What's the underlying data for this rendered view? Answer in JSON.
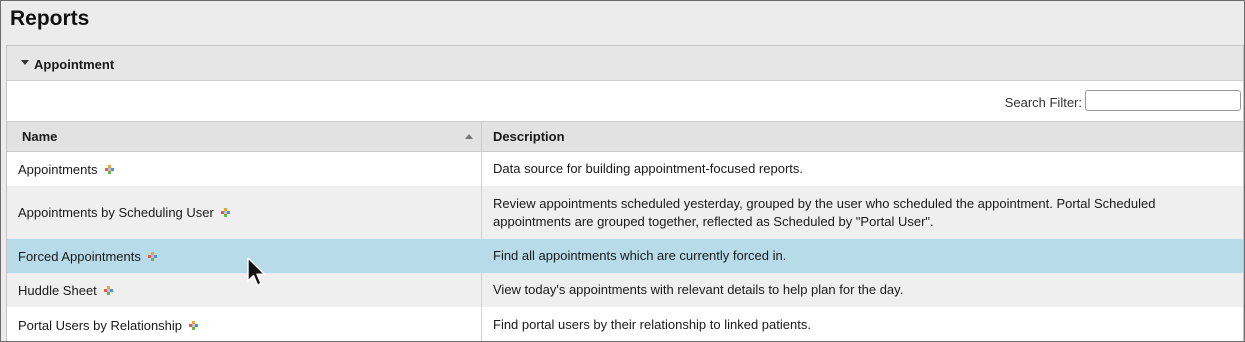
{
  "page": {
    "title": "Reports"
  },
  "section": {
    "label": "Appointment"
  },
  "filter": {
    "label": "Search Filter:",
    "value": ""
  },
  "table": {
    "columns": {
      "name": "Name",
      "description": "Description"
    },
    "sort": {
      "column": "Name",
      "direction": "ascending"
    },
    "rows": [
      {
        "name": "Appointments",
        "description": "Data source for building appointment-focused reports."
      },
      {
        "name": "Appointments by Scheduling User",
        "description": "Review appointments scheduled yesterday, grouped by the user who scheduled the appointment. Portal Scheduled appointments are grouped together, reflected as Scheduled by \"Portal User\"."
      },
      {
        "name": "Forced Appointments",
        "description": "Find all appointments which are currently forced in.",
        "selected": true
      },
      {
        "name": "Huddle Sheet",
        "description": "View today's appointments with relevant details to help plan for the day."
      },
      {
        "name": "Portal Users by Relationship",
        "description": "Find portal users by their relationship to linked patients."
      }
    ]
  },
  "icons": {
    "row_icon": "add-favorite-plus-icon",
    "section_toggle": "caret-down-icon",
    "sort": "sort-ascending-icon",
    "cursor": "mouse-pointer-icon"
  },
  "colors": {
    "selected_row": "#b7dbe8",
    "alt_row": "#efefef",
    "header_bg": "#e2e2e2",
    "plus_orange": "#e8a53b",
    "plus_red": "#e35b4b",
    "plus_blue": "#4d91d6",
    "plus_green": "#6cb54a"
  }
}
